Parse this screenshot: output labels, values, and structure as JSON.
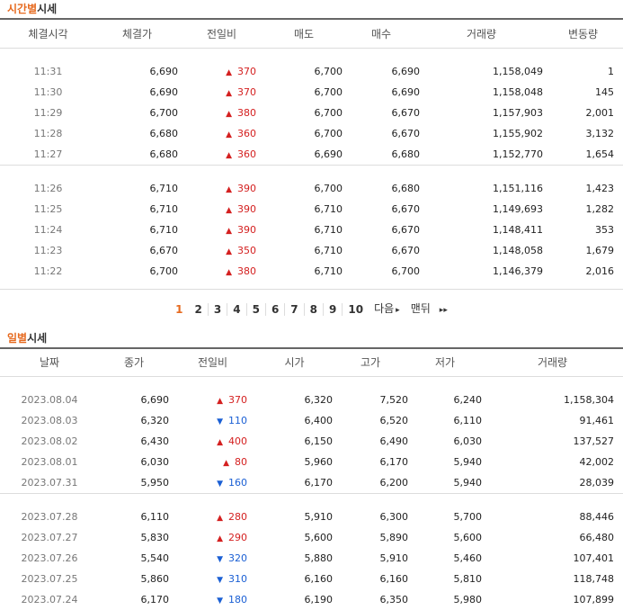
{
  "time_section": {
    "title_highlight": "시간별",
    "title_rest": "시세",
    "headers": [
      "체결시각",
      "체결가",
      "전일비",
      "매도",
      "매수",
      "거래량",
      "변동량"
    ],
    "groups": [
      [
        {
          "time": "11:31",
          "price": "6,690",
          "dir": "up",
          "change": "370",
          "ask": "6,700",
          "bid": "6,690",
          "volume": "1,158,049",
          "delta": "1"
        },
        {
          "time": "11:30",
          "price": "6,690",
          "dir": "up",
          "change": "370",
          "ask": "6,700",
          "bid": "6,690",
          "volume": "1,158,048",
          "delta": "145"
        },
        {
          "time": "11:29",
          "price": "6,700",
          "dir": "up",
          "change": "380",
          "ask": "6,700",
          "bid": "6,670",
          "volume": "1,157,903",
          "delta": "2,001"
        },
        {
          "time": "11:28",
          "price": "6,680",
          "dir": "up",
          "change": "360",
          "ask": "6,700",
          "bid": "6,670",
          "volume": "1,155,902",
          "delta": "3,132"
        },
        {
          "time": "11:27",
          "price": "6,680",
          "dir": "up",
          "change": "360",
          "ask": "6,690",
          "bid": "6,680",
          "volume": "1,152,770",
          "delta": "1,654"
        }
      ],
      [
        {
          "time": "11:26",
          "price": "6,710",
          "dir": "up",
          "change": "390",
          "ask": "6,700",
          "bid": "6,680",
          "volume": "1,151,116",
          "delta": "1,423"
        },
        {
          "time": "11:25",
          "price": "6,710",
          "dir": "up",
          "change": "390",
          "ask": "6,710",
          "bid": "6,670",
          "volume": "1,149,693",
          "delta": "1,282"
        },
        {
          "time": "11:24",
          "price": "6,710",
          "dir": "up",
          "change": "390",
          "ask": "6,710",
          "bid": "6,670",
          "volume": "1,148,411",
          "delta": "353"
        },
        {
          "time": "11:23",
          "price": "6,670",
          "dir": "up",
          "change": "350",
          "ask": "6,710",
          "bid": "6,670",
          "volume": "1,148,058",
          "delta": "1,679"
        },
        {
          "time": "11:22",
          "price": "6,700",
          "dir": "up",
          "change": "380",
          "ask": "6,710",
          "bid": "6,700",
          "volume": "1,146,379",
          "delta": "2,016"
        }
      ]
    ]
  },
  "pagination": {
    "pages": [
      "1",
      "2",
      "3",
      "4",
      "5",
      "6",
      "7",
      "8",
      "9",
      "10"
    ],
    "active": "1",
    "next_label": "다음",
    "next_arrow": "▸",
    "last_label": "맨뒤",
    "last_arrow": "▸▸"
  },
  "daily_section": {
    "title_highlight": "일별",
    "title_rest": "시세",
    "headers": [
      "날짜",
      "종가",
      "전일비",
      "시가",
      "고가",
      "저가",
      "거래량"
    ],
    "groups": [
      [
        {
          "date": "2023.08.04",
          "close": "6,690",
          "dir": "up",
          "change": "370",
          "open": "6,320",
          "high": "7,520",
          "low": "6,240",
          "volume": "1,158,304"
        },
        {
          "date": "2023.08.03",
          "close": "6,320",
          "dir": "down",
          "change": "110",
          "open": "6,400",
          "high": "6,520",
          "low": "6,110",
          "volume": "91,461"
        },
        {
          "date": "2023.08.02",
          "close": "6,430",
          "dir": "up",
          "change": "400",
          "open": "6,150",
          "high": "6,490",
          "low": "6,030",
          "volume": "137,527"
        },
        {
          "date": "2023.08.01",
          "close": "6,030",
          "dir": "up",
          "change": "80",
          "open": "5,960",
          "high": "6,170",
          "low": "5,940",
          "volume": "42,002"
        },
        {
          "date": "2023.07.31",
          "close": "5,950",
          "dir": "down",
          "change": "160",
          "open": "6,170",
          "high": "6,200",
          "low": "5,940",
          "volume": "28,039"
        }
      ],
      [
        {
          "date": "2023.07.28",
          "close": "6,110",
          "dir": "up",
          "change": "280",
          "open": "5,910",
          "high": "6,300",
          "low": "5,700",
          "volume": "88,446"
        },
        {
          "date": "2023.07.27",
          "close": "5,830",
          "dir": "up",
          "change": "290",
          "open": "5,600",
          "high": "5,890",
          "low": "5,600",
          "volume": "66,480"
        },
        {
          "date": "2023.07.26",
          "close": "5,540",
          "dir": "down",
          "change": "320",
          "open": "5,880",
          "high": "5,910",
          "low": "5,460",
          "volume": "107,401"
        },
        {
          "date": "2023.07.25",
          "close": "5,860",
          "dir": "down",
          "change": "310",
          "open": "6,160",
          "high": "6,160",
          "low": "5,810",
          "volume": "118,748"
        },
        {
          "date": "2023.07.24",
          "close": "6,170",
          "dir": "down",
          "change": "180",
          "open": "6,190",
          "high": "6,350",
          "low": "5,980",
          "volume": "107,899"
        }
      ]
    ]
  },
  "icons": {
    "up": "▲",
    "down": "▼"
  },
  "colors": {
    "accent": "#e66a1f",
    "up": "#d42020",
    "down": "#1a5fd4"
  }
}
